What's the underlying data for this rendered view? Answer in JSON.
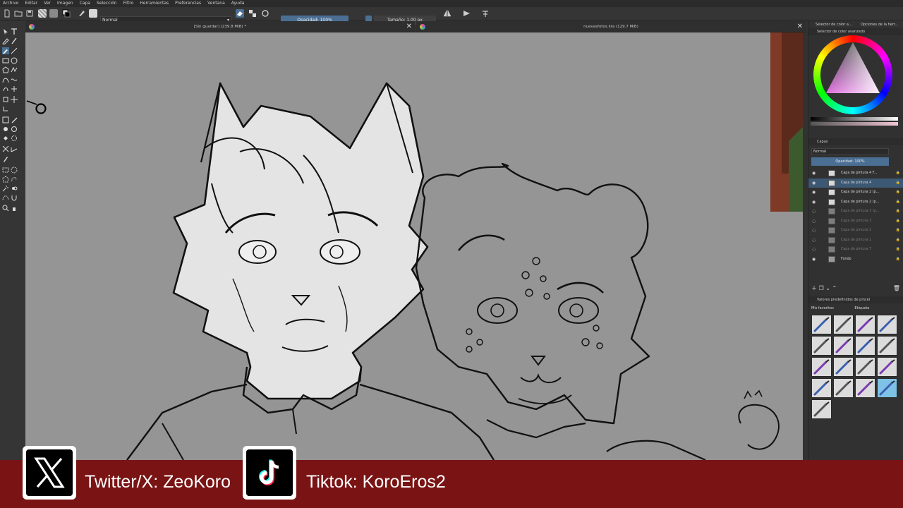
{
  "menu": [
    "Archivo",
    "Editar",
    "Ver",
    "Imagen",
    "Capa",
    "Selección",
    "Filtro",
    "Herramientas",
    "Preferencias",
    "Ventana",
    "Ayuda"
  ],
  "tool_options": {
    "blend_mode": "Normal",
    "opacity_label": "Opacidad: 100%",
    "size_label": "Tamaño: 1.00 px"
  },
  "tabs": [
    {
      "title": "[Sin guardar] (239.8 MiB) *"
    },
    {
      "title": "nuevasfotos.kra (129.7 MiB)"
    }
  ],
  "dock": {
    "top_tabs": [
      "Selector de color a...",
      "Opciones de la herr..."
    ],
    "color_panel_title": "Selector de color avanzado",
    "layers_title": "Capas",
    "layers_blend": "Normal",
    "layers_opacity": "Opacidad: 100%",
    "layers": [
      {
        "name": "Capa de pintura 4 F...",
        "visible": true,
        "selected": false,
        "dim": false
      },
      {
        "name": "Capa de pintura 4",
        "visible": true,
        "selected": true,
        "dim": false
      },
      {
        "name": "Capa de pintura 2 (p...",
        "visible": true,
        "selected": false,
        "dim": false
      },
      {
        "name": "Capa de pintura 2 (p...",
        "visible": true,
        "selected": false,
        "dim": false
      },
      {
        "name": "Capa de pintura 3 (p...",
        "visible": false,
        "selected": false,
        "dim": true
      },
      {
        "name": "Capa de pintura 3",
        "visible": false,
        "selected": false,
        "dim": true
      },
      {
        "name": "Capa de pintura 2",
        "visible": false,
        "selected": false,
        "dim": true
      },
      {
        "name": "Capa de pintura 1",
        "visible": false,
        "selected": false,
        "dim": true
      },
      {
        "name": "Capa de pintura 7",
        "visible": false,
        "selected": false,
        "dim": true
      },
      {
        "name": "Fondo",
        "visible": true,
        "selected": false,
        "dim": false
      }
    ],
    "brush_title": "Valores predefinidos de pincel",
    "brush_filter": "Mis favoritos",
    "brush_tag": "Etiqueta"
  },
  "social": {
    "twitter": "Twitter/X: ZeoKoro",
    "tiktok": "Tiktok: KoroEros2"
  },
  "colors": {
    "banner": "#7a1414",
    "canvas": "#959595",
    "accent": "#4b6f93"
  }
}
